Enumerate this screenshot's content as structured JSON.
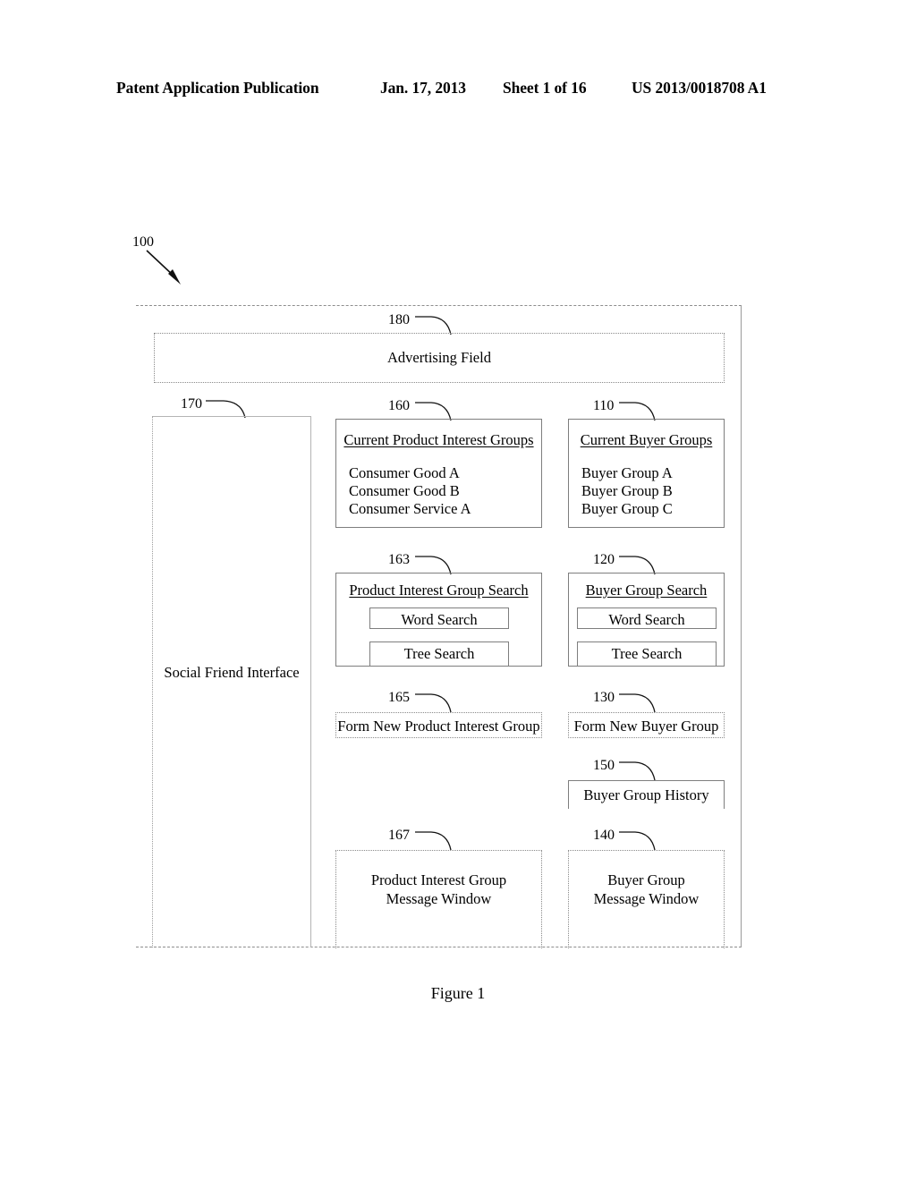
{
  "header": {
    "publication": "Patent Application Publication",
    "date": "Jan. 17, 2013",
    "sheet": "Sheet 1 of 16",
    "patent_number": "US 2013/0018708 A1"
  },
  "figure": {
    "caption": "Figure 1",
    "system_ref": "100"
  },
  "advertising_field": {
    "ref": "180",
    "label": "Advertising Field"
  },
  "social_friend_interface": {
    "ref": "170",
    "label": "Social Friend Interface"
  },
  "current_product_interest_groups": {
    "ref": "160",
    "heading": "Current Product Interest Groups",
    "items": [
      "Consumer Good A",
      "Consumer Good B",
      "Consumer Service A"
    ]
  },
  "current_buyer_groups": {
    "ref": "110",
    "heading": "Current Buyer Groups",
    "items": [
      "Buyer Group A",
      "Buyer Group B",
      "Buyer Group C"
    ]
  },
  "product_interest_group_search": {
    "ref": "163",
    "heading": "Product Interest Group Search",
    "word_search": "Word Search",
    "tree_search": "Tree Search"
  },
  "buyer_group_search": {
    "ref": "120",
    "heading": "Buyer Group Search",
    "word_search": "Word Search",
    "tree_search": "Tree Search"
  },
  "form_new_product_interest_group": {
    "ref": "165",
    "label": "Form New Product Interest Group"
  },
  "form_new_buyer_group": {
    "ref": "130",
    "label": "Form New Buyer Group"
  },
  "buyer_group_history": {
    "ref": "150",
    "label": "Buyer Group History"
  },
  "product_interest_group_message_window": {
    "ref": "167",
    "line1": "Product Interest Group",
    "line2": "Message Window"
  },
  "buyer_group_message_window": {
    "ref": "140",
    "line1": "Buyer Group",
    "line2": "Message Window"
  }
}
